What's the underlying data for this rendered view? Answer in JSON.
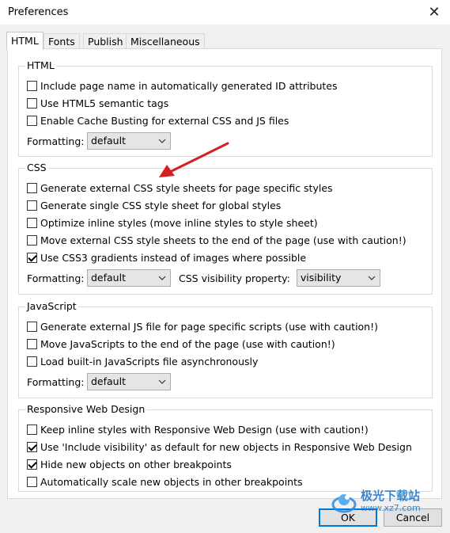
{
  "window": {
    "title": "Preferences",
    "close_glyph": "✕"
  },
  "tabs": [
    "HTML",
    "Fonts",
    "Publish",
    "Miscellaneous"
  ],
  "html_group": {
    "legend": "HTML",
    "options": [
      {
        "label": "Include page name in automatically generated ID attributes",
        "checked": false
      },
      {
        "label": "Use HTML5 semantic tags",
        "checked": false
      },
      {
        "label": "Enable Cache Busting for external CSS and JS files",
        "checked": false
      }
    ],
    "formatting_label": "Formatting:",
    "formatting_value": "default"
  },
  "css_group": {
    "legend": "CSS",
    "options": [
      {
        "label": "Generate external CSS style sheets for page specific styles",
        "checked": false
      },
      {
        "label": "Generate single CSS style sheet for global styles",
        "checked": false
      },
      {
        "label": "Optimize inline styles (move inline styles to style sheet)",
        "checked": false
      },
      {
        "label": "Move external CSS style sheets to the end of the page (use with caution!)",
        "checked": false
      },
      {
        "label": "Use CSS3 gradients instead of images where possible",
        "checked": true
      }
    ],
    "formatting_label": "Formatting:",
    "formatting_value": "default",
    "visibility_label": "CSS visibility property:",
    "visibility_value": "visibility"
  },
  "js_group": {
    "legend": "JavaScript",
    "options": [
      {
        "label": "Generate external JS file for page specific scripts (use with caution!)",
        "checked": false
      },
      {
        "label": "Move JavaScripts to the end of the page (use with caution!)",
        "checked": false
      },
      {
        "label": "Load built-in JavaScripts file asynchronously",
        "checked": false
      }
    ],
    "formatting_label": "Formatting:",
    "formatting_value": "default"
  },
  "rwd_group": {
    "legend": "Responsive Web Design",
    "options": [
      {
        "label": "Keep inline styles with Responsive Web Design (use with caution!)",
        "checked": false
      },
      {
        "label": "Use 'Include visibility' as default for new objects in Responsive Web Design",
        "checked": true
      },
      {
        "label": "Hide new objects on other breakpoints",
        "checked": true
      },
      {
        "label": "Automatically scale new objects in other breakpoints",
        "checked": false
      }
    ]
  },
  "buttons": {
    "ok": "OK",
    "cancel": "Cancel"
  },
  "watermark": {
    "text": "极光下载站",
    "url": "www.xz7.com"
  },
  "colors": {
    "accent": "#0078d7",
    "annotation_arrow": "#d42020"
  },
  "icons": {
    "close": "close-icon",
    "dropdown": "chevron-down-icon",
    "check": "checkmark-icon"
  }
}
